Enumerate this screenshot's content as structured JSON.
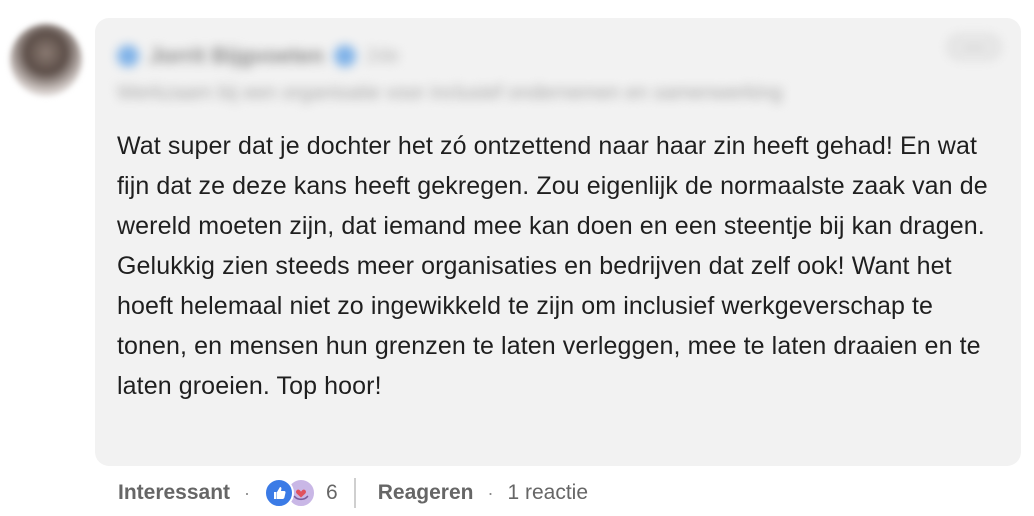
{
  "comment": {
    "author": {
      "name": "Jorrit Bijgvoeten",
      "meta": "2de",
      "headline": "Werkzaam bij een organisatie voor inclusief ondernemen en samenwerking"
    },
    "menu_label": "···",
    "text": "Wat super dat je dochter het zó ontzettend naar haar zin heeft gehad! En wat fijn dat ze deze kans heeft gekregen. Zou eigenlijk de normaalste zaak van de wereld moeten zijn, dat iemand mee kan doen en een steentje bij kan dragen. Gelukkig zien steeds meer organisaties en bedrijven dat zelf ook! Want het hoeft helemaal niet zo ingewikkeld te zijn om inclusief werkgeverschap te tonen, en mensen hun grenzen te laten verleggen, mee te laten draaien en te laten groeien. Top hoor!"
  },
  "actions": {
    "react_label": "Interessant",
    "separator": "·",
    "reaction_icons": [
      "thumbs-up-icon",
      "heart-hands-icon"
    ],
    "reaction_count": "6",
    "reply_label": "Reageren",
    "replies": "1 reactie"
  },
  "colors": {
    "bubble": "#f2f2f2",
    "text": "#1f1f1f",
    "muted": "#666666",
    "like_blue": "#3b7be6"
  }
}
